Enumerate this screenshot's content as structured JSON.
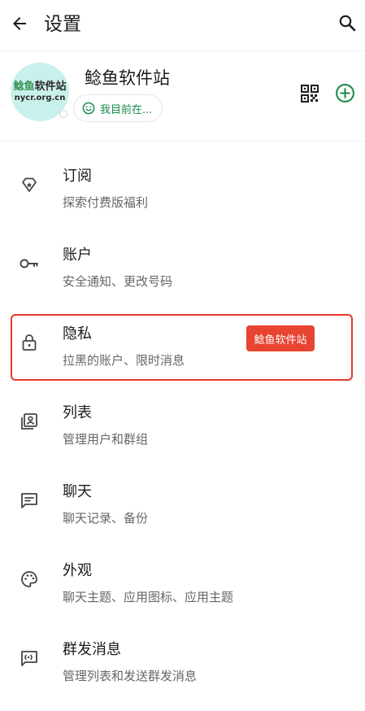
{
  "header": {
    "title": "设置"
  },
  "profile": {
    "name": "鲶鱼软件站",
    "status": "我目前在...",
    "avatar_text_main": "鲶鱼",
    "avatar_text_rest": "软件站",
    "avatar_text_sub": "nycr.org.cn"
  },
  "menu": [
    {
      "icon": "diamond-icon",
      "title": "订阅",
      "subtitle": "探索付费版福利"
    },
    {
      "icon": "key-icon",
      "title": "账户",
      "subtitle": "安全通知、更改号码"
    },
    {
      "icon": "lock-icon",
      "title": "隐私",
      "subtitle": "拉黑的账户、限时消息"
    },
    {
      "icon": "contact-list-icon",
      "title": "列表",
      "subtitle": "管理用户和群组"
    },
    {
      "icon": "chat-icon",
      "title": "聊天",
      "subtitle": "聊天记录、备份"
    },
    {
      "icon": "palette-icon",
      "title": "外观",
      "subtitle": "聊天主题、应用图标、应用主题"
    },
    {
      "icon": "broadcast-icon",
      "title": "群发消息",
      "subtitle": "管理列表和发送群发消息"
    }
  ],
  "watermark": "鲶鱼软件站",
  "colors": {
    "accent_green": "#1a8b4a",
    "highlight_red": "#e43a2c",
    "avatar_bg": "#c9f1ec"
  }
}
